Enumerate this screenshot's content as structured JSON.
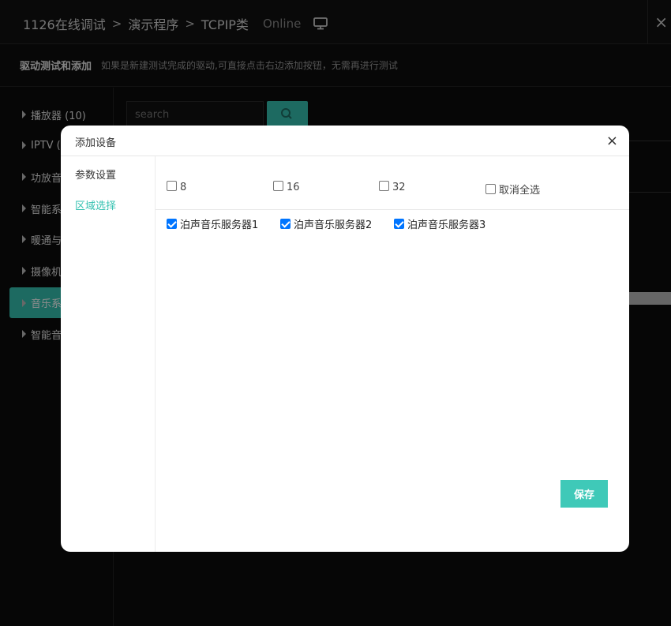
{
  "topbar": {
    "breadcrumb": [
      "1126在线调试",
      "演示程序",
      "TCPIP类"
    ],
    "separator": ">",
    "status": "Online",
    "close_glyph": "×"
  },
  "subbar": {
    "title": "驱动测试和添加",
    "description": "如果是新建测试完成的驱动,可直接点击右边添加按钮，无需再进行测试"
  },
  "sidebar": {
    "items": [
      {
        "label": "播放器 (10)",
        "active": false
      },
      {
        "label": "IPTV (1",
        "active": false
      },
      {
        "label": "功放音",
        "active": false
      },
      {
        "label": "智能系",
        "active": false
      },
      {
        "label": "暖通与",
        "active": false
      },
      {
        "label": "摄像机",
        "active": false
      },
      {
        "label": "音乐系",
        "active": true
      },
      {
        "label": "智能音",
        "active": false
      }
    ]
  },
  "search": {
    "placeholder": "search",
    "icon": "search-icon"
  },
  "modal": {
    "title": "添加设备",
    "close_glyph": "×",
    "nav": [
      {
        "label": "参数设置",
        "active": false
      },
      {
        "label": "区域选择",
        "active": true
      }
    ],
    "bulk_options": [
      {
        "label": "8",
        "checked": false
      },
      {
        "label": "16",
        "checked": false
      },
      {
        "label": "32",
        "checked": false
      },
      {
        "label": "取消全选",
        "checked": false
      }
    ],
    "zones": [
      {
        "label": "泊声音乐服务器1",
        "checked": true
      },
      {
        "label": "泊声音乐服务器2",
        "checked": true
      },
      {
        "label": "泊声音乐服务器3",
        "checked": true
      }
    ],
    "save_label": "保存"
  },
  "colors": {
    "accent": "#35c2b1",
    "checkbox": "#0075ff"
  }
}
